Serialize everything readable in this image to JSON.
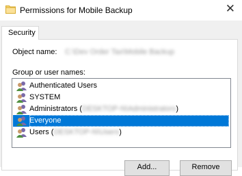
{
  "window": {
    "title": "Permissions for Mobile Backup",
    "close_glyph": "✕"
  },
  "tabs": [
    {
      "label": "Security"
    }
  ],
  "object_name": {
    "label": "Object name:",
    "value": "C:\\Dev Order Tax\\Mobile Backup"
  },
  "group_section": {
    "label": "Group or user names:"
  },
  "principals": [
    {
      "name": "Authenticated Users",
      "suffix": "",
      "icon": "users-icon"
    },
    {
      "name": "SYSTEM",
      "suffix": "",
      "icon": "users-icon"
    },
    {
      "name": "Administrators (",
      "suffix": "DESKTOP-N\\Administrators",
      "close": ")",
      "icon": "users-icon"
    },
    {
      "name": "Everyone",
      "suffix": "",
      "icon": "users-icon",
      "selected": true
    },
    {
      "name": "Users (",
      "suffix": "DESKTOP-N\\Users",
      "close": ")",
      "icon": "users-icon"
    }
  ],
  "buttons": {
    "add": "Add...",
    "remove": "Remove"
  },
  "colors": {
    "selection": "#0078d7",
    "dialog_bg": "#f0f0f0",
    "folder": "#f8d775"
  }
}
